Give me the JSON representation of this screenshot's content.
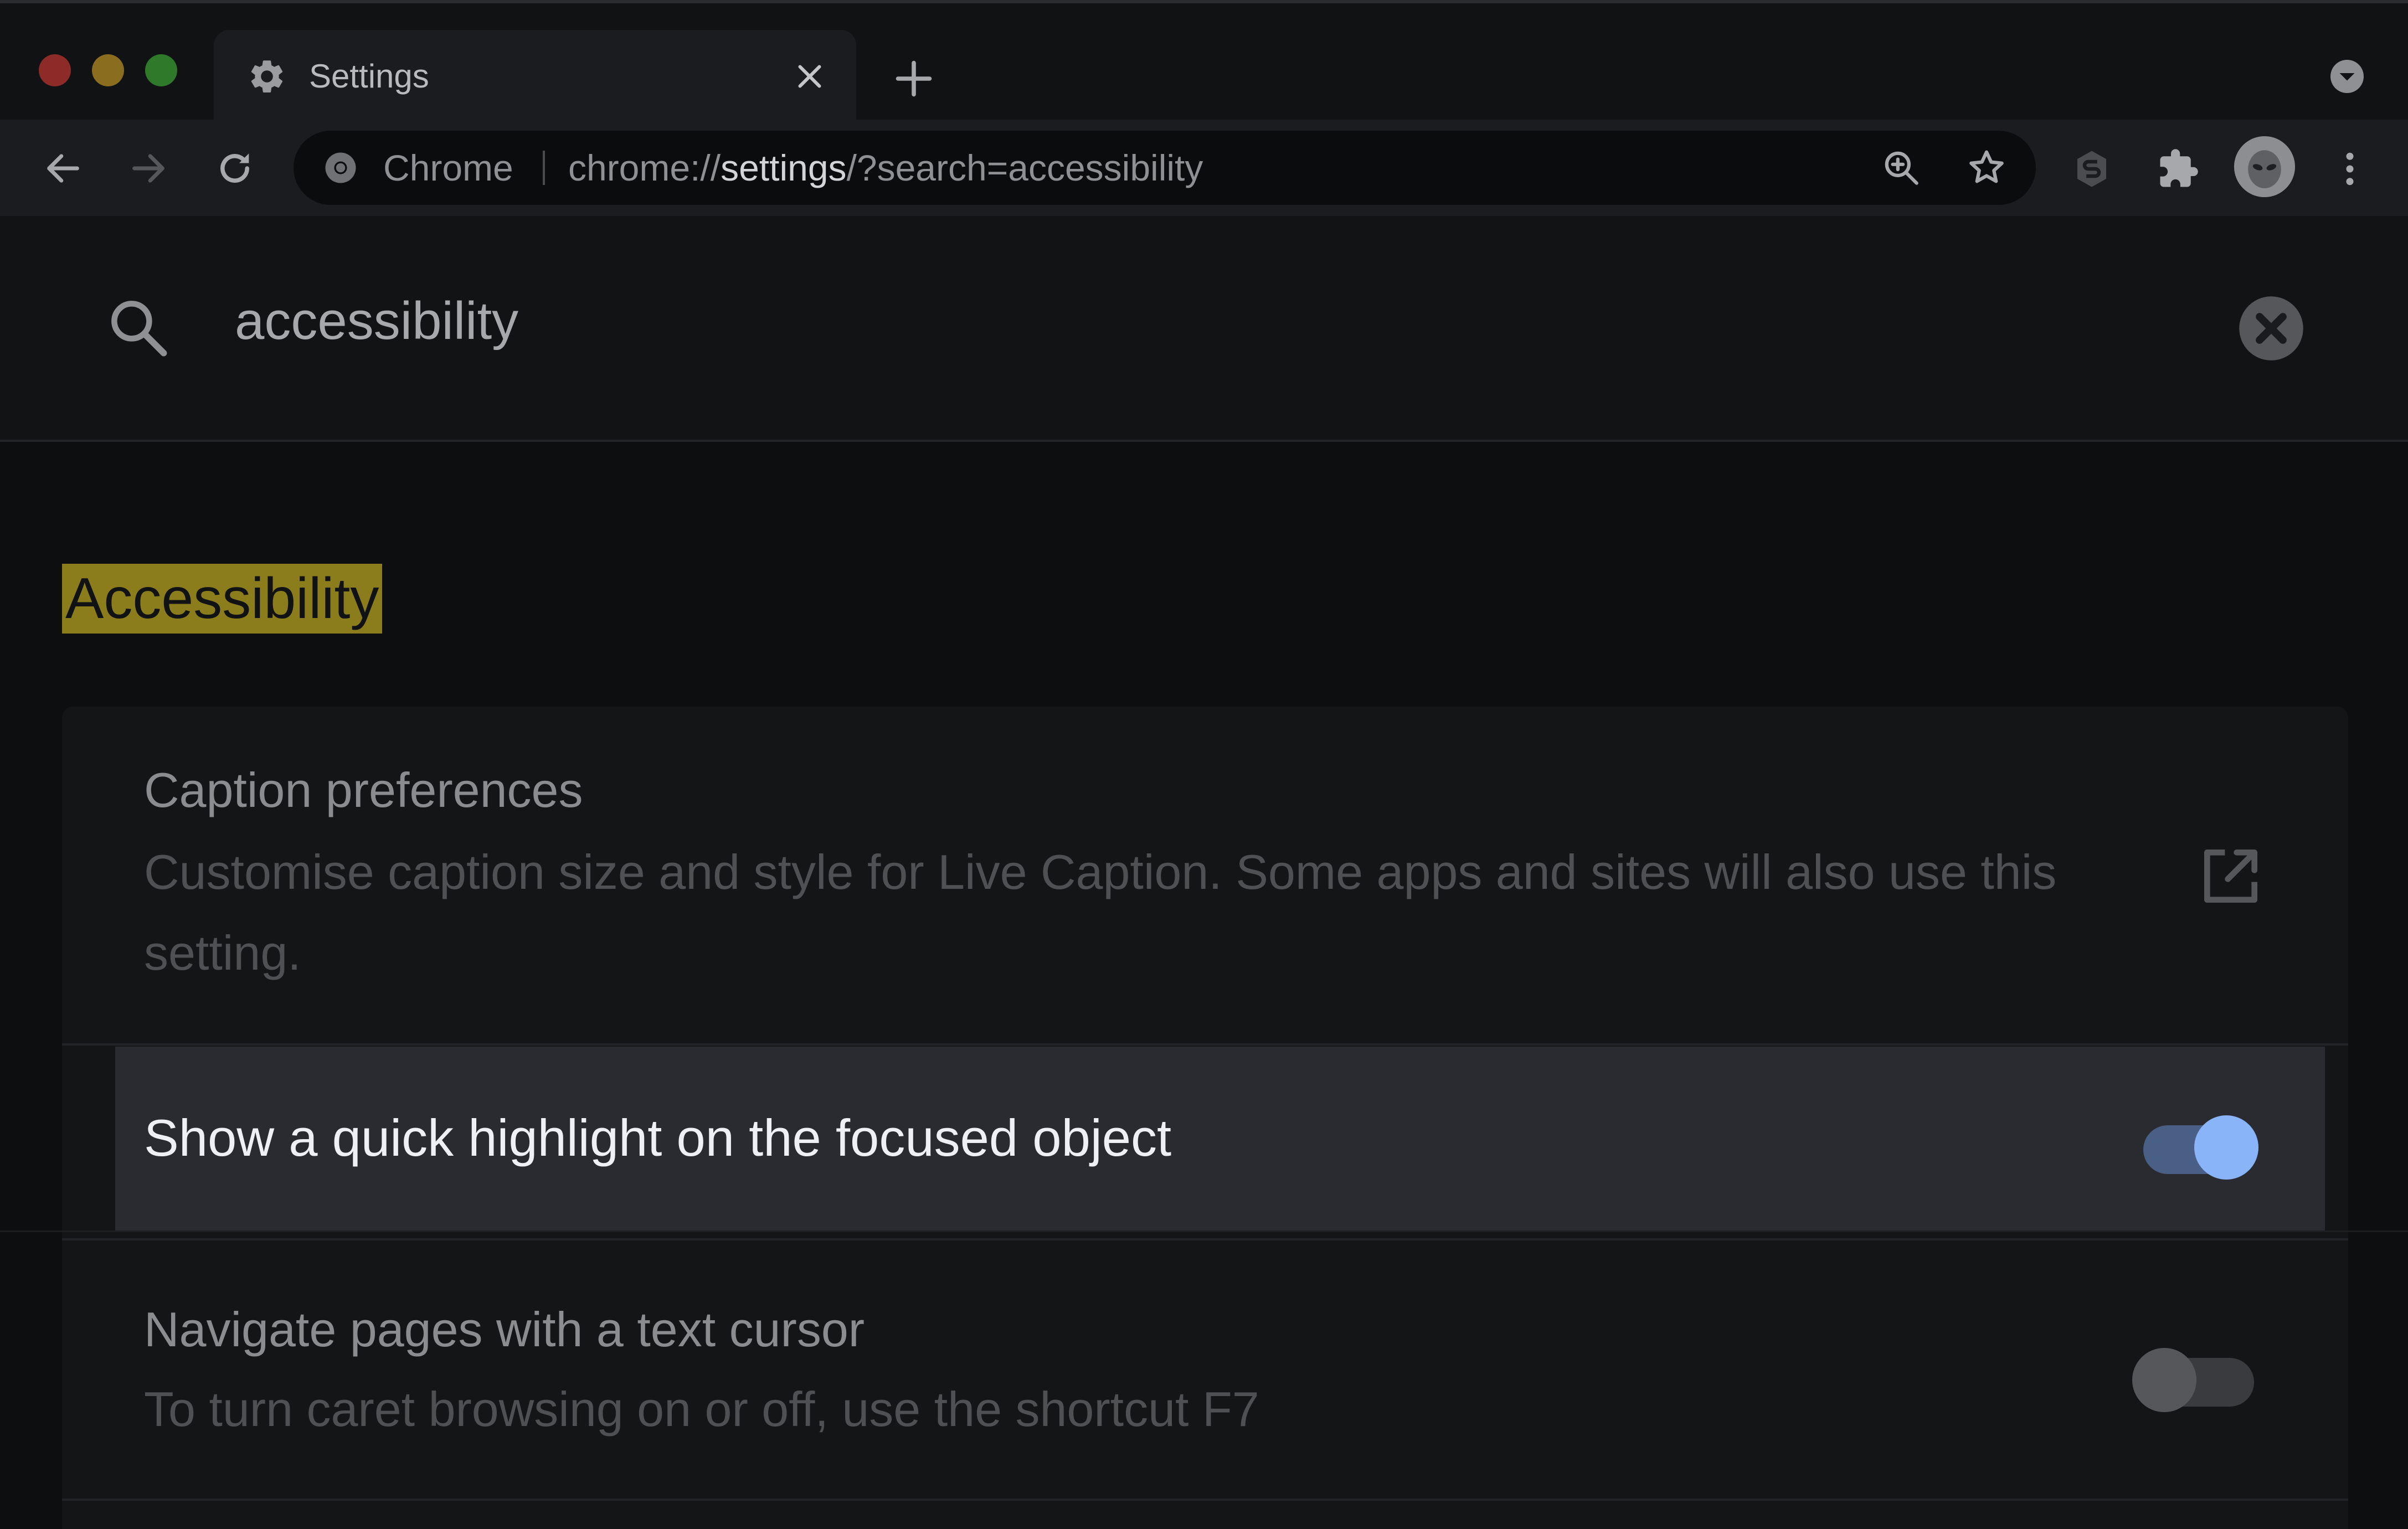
{
  "window": {
    "controls": [
      "close",
      "minimize",
      "maximize"
    ]
  },
  "tab": {
    "title": "Settings",
    "icon": "gear-icon"
  },
  "omnibox": {
    "chip_label": "Chrome",
    "url_scheme": "chrome://",
    "url_host": "settings",
    "url_path": "/?search=accessibility"
  },
  "search": {
    "value": "accessibility"
  },
  "section": {
    "title": "Accessibility"
  },
  "settings": {
    "caption": {
      "title": "Caption preferences",
      "description": "Customise caption size and style for Live Caption. Some apps and sites will also use this setting."
    },
    "focus_highlight": {
      "title": "Show a quick highlight on the focused object",
      "enabled": true
    },
    "caret_browsing": {
      "title": "Navigate pages with a text cursor",
      "description": "To turn caret browsing on or off, use the shortcut F7",
      "enabled": false
    }
  },
  "colors": {
    "accent": "#8ab4f8",
    "search_highlight": "#8c7d1c",
    "background": "#0d0e10"
  }
}
